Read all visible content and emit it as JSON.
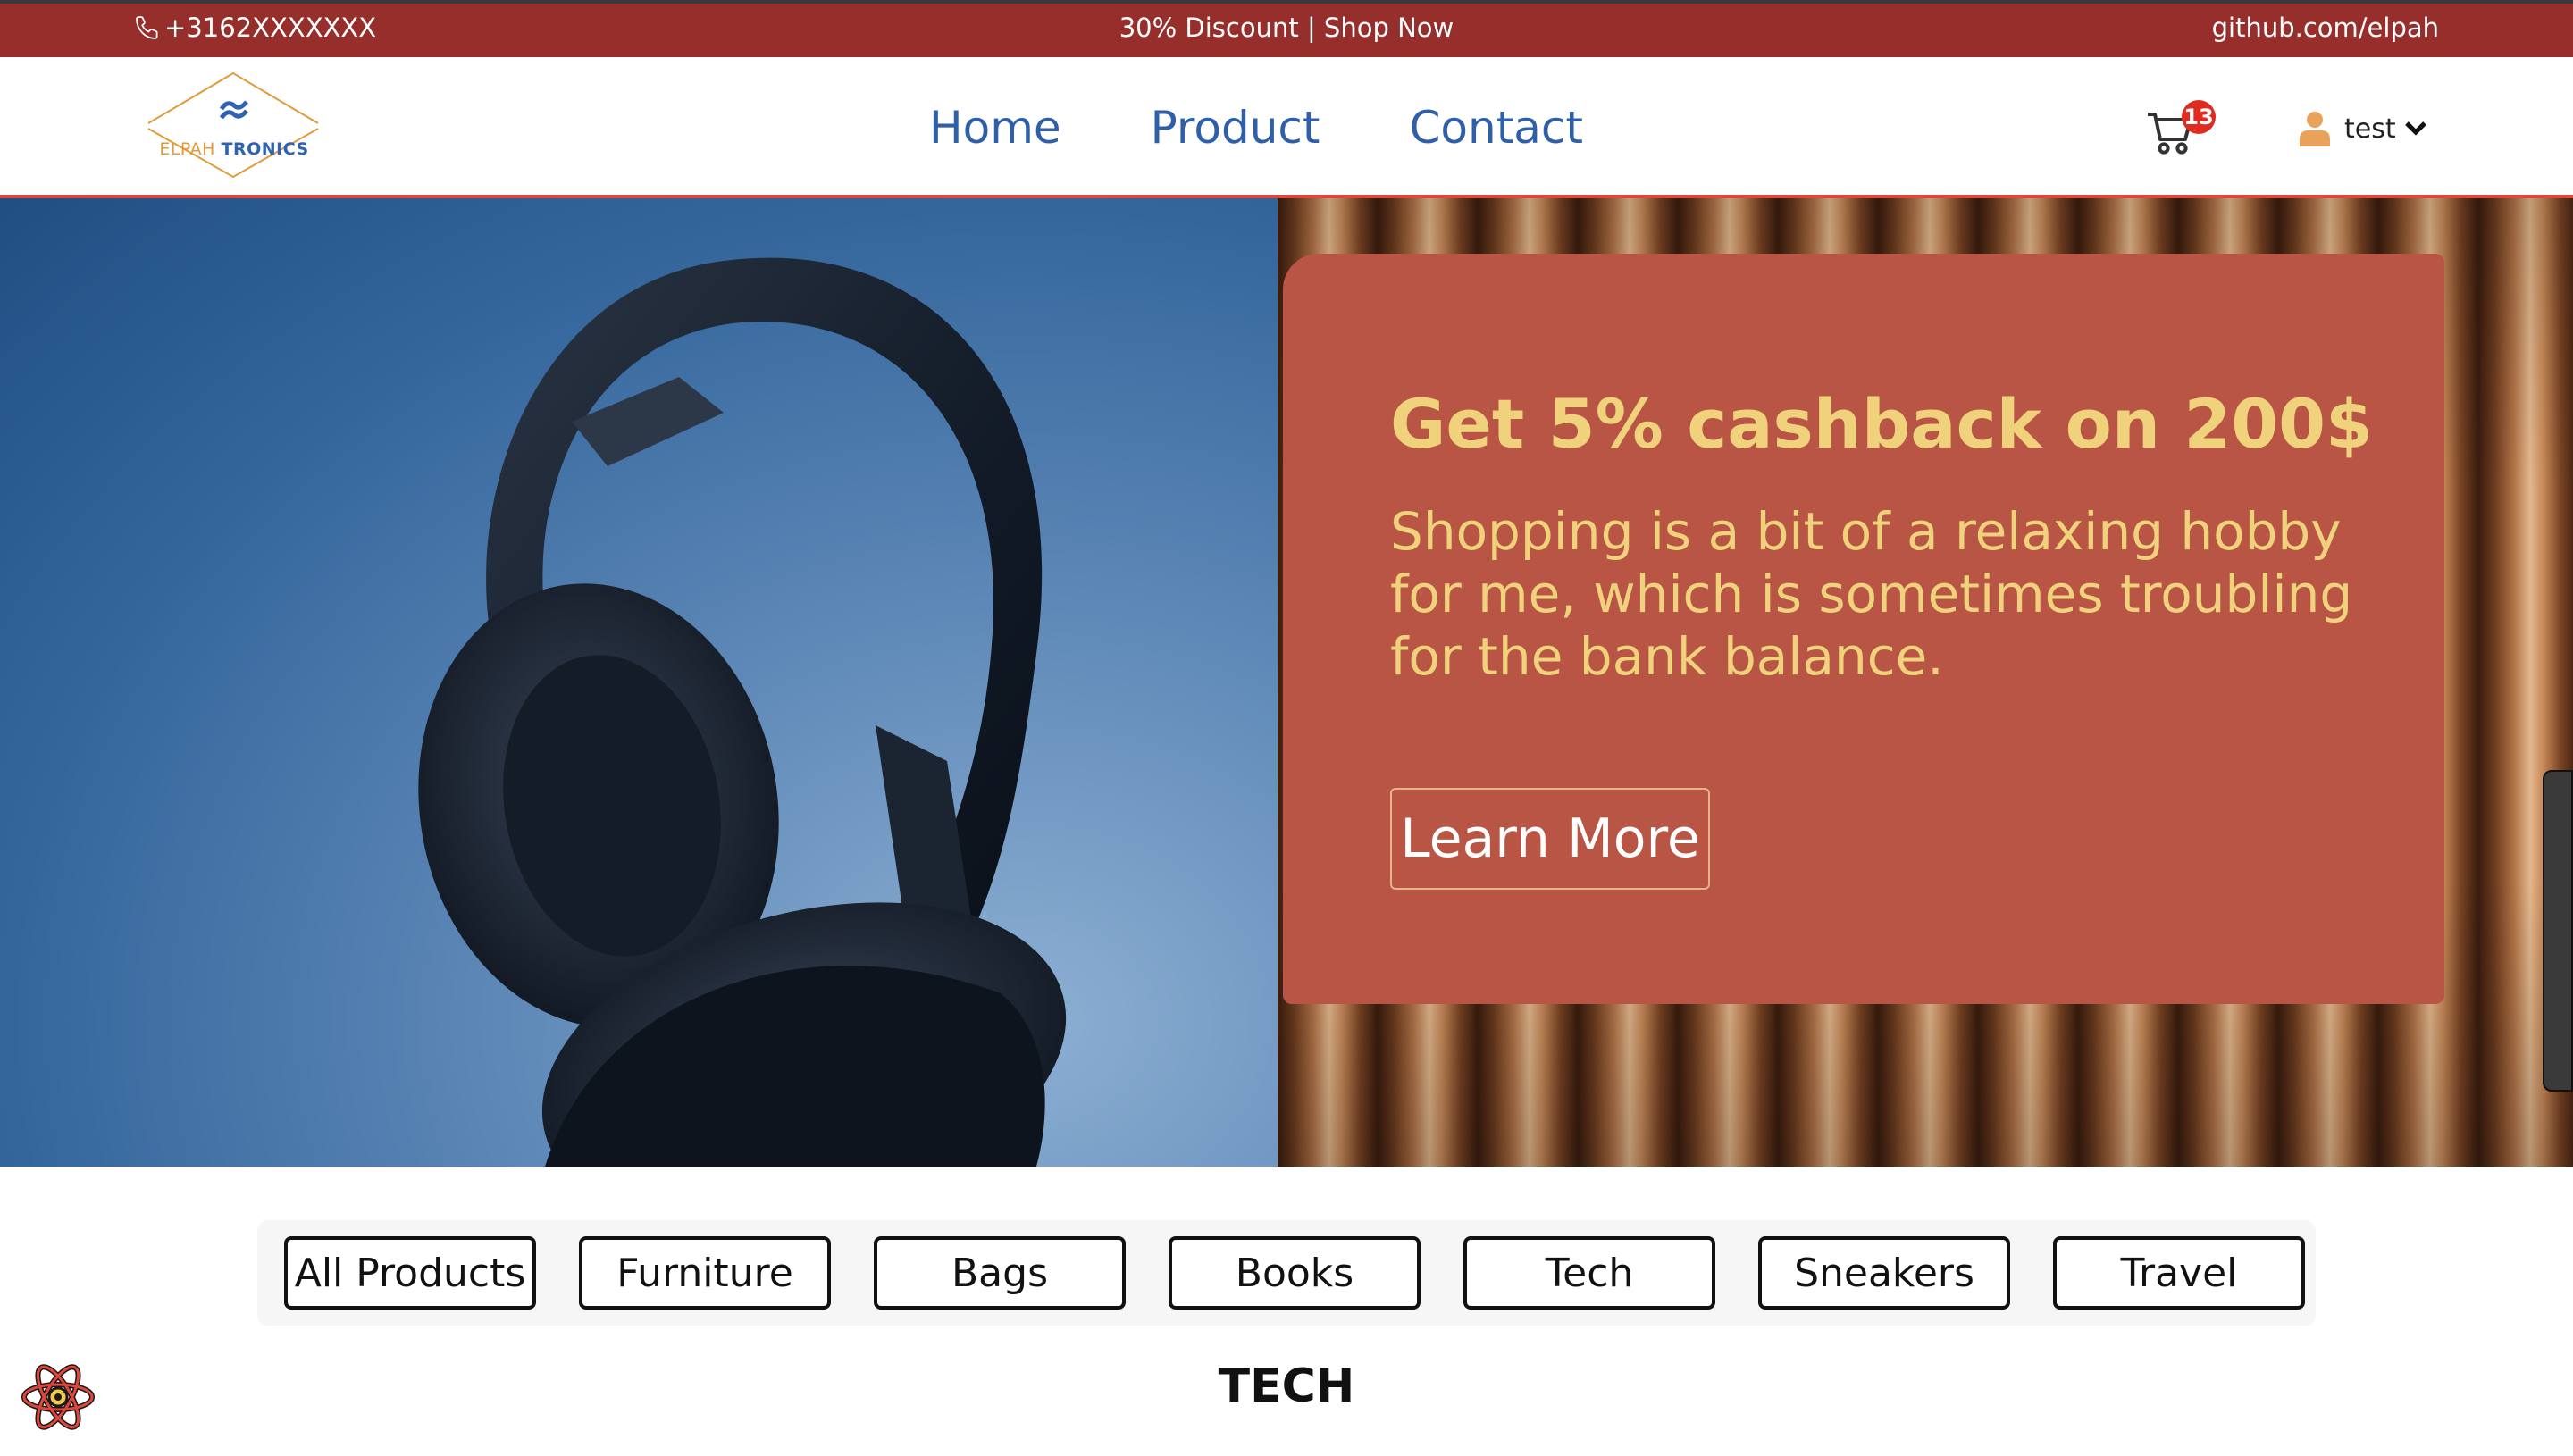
{
  "topbar": {
    "phone": "+3162XXXXXXX",
    "promo": "30% Discount | Shop Now",
    "github": "github.com/elpah"
  },
  "logo": {
    "part1": "ELPAH",
    "part2": "TRONICS"
  },
  "nav": {
    "links": [
      "Home",
      "Product",
      "Contact"
    ]
  },
  "cart": {
    "count": "13",
    "icon": "shopping-cart-icon"
  },
  "user": {
    "name": "test",
    "icon": "user-icon",
    "dropdown_icon": "chevron-down-icon"
  },
  "hero": {
    "title": "Get 5% cashback on 200$",
    "description": "Shopping is a bit of a relaxing hobby for me, which is sometimes troubling for the bank balance.",
    "button": "Learn More"
  },
  "categories": [
    "All Products",
    "Furniture",
    "Bags",
    "Books",
    "Tech",
    "Sneakers",
    "Travel"
  ],
  "section": {
    "title": "TECH"
  },
  "colors": {
    "topbar": "#962f2b",
    "accent_line": "#e0473c",
    "nav_link": "#2f5fa9",
    "promo_card": "#b85545",
    "promo_text": "#f0d27c",
    "badge": "#e02b20"
  }
}
